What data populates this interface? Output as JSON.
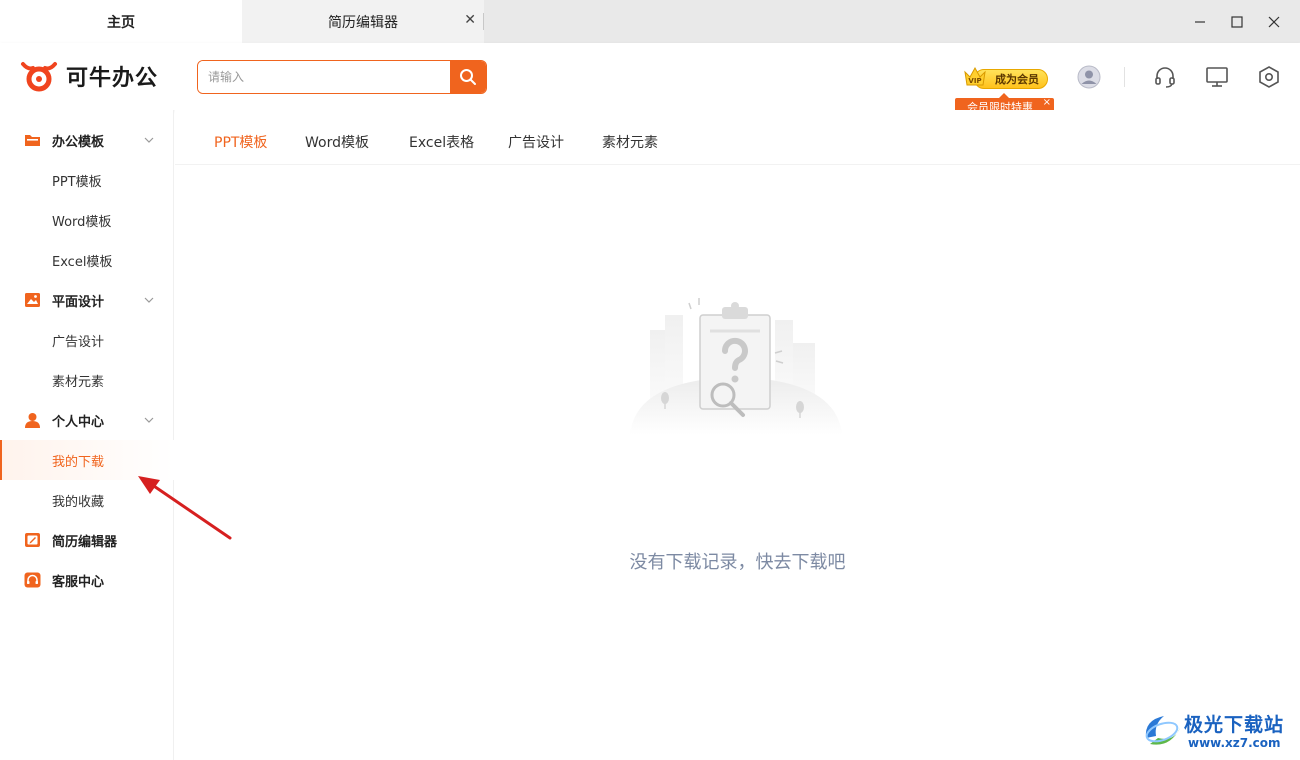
{
  "tabs": [
    {
      "label": "主页",
      "active": true
    },
    {
      "label": "简历编辑器",
      "active": false,
      "close": "✕"
    }
  ],
  "window_controls": [
    "minimize-icon",
    "maximize-icon",
    "close-icon"
  ],
  "header": {
    "app_name": "可牛办公",
    "search": {
      "placeholder": "请输入",
      "value": ""
    },
    "vip_label": "成为会员",
    "vip_badge_text": "VIP",
    "promo_label": "会员限时特惠",
    "promo_close": "×",
    "icons": [
      "avatar-icon",
      "headset-icon",
      "monitor-icon",
      "settings-icon"
    ]
  },
  "sidebar": {
    "groups": [
      {
        "label": "办公模板",
        "icon": "folder-icon",
        "expanded": true,
        "items": [
          "PPT模板",
          "Word模板",
          "Excel模板"
        ]
      },
      {
        "label": "平面设计",
        "icon": "image-icon",
        "expanded": true,
        "items": [
          "广告设计",
          "素材元素"
        ]
      },
      {
        "label": "个人中心",
        "icon": "user-icon",
        "expanded": true,
        "items": [
          "我的下载",
          "我的收藏"
        ]
      },
      {
        "label": "简历编辑器",
        "icon": "edit-icon",
        "expanded": false,
        "items": []
      },
      {
        "label": "客服中心",
        "icon": "headset-icon",
        "expanded": false,
        "items": []
      }
    ],
    "active_item": "我的下载"
  },
  "content": {
    "tabs": [
      "PPT模板",
      "Word模板",
      "Excel表格",
      "广告设计",
      "素材元素"
    ],
    "active_tab": "PPT模板",
    "empty_message": "没有下载记录，快去下载吧"
  },
  "watermark": {
    "title": "极光下载站",
    "url": "www.xz7.com"
  },
  "colors": {
    "accent": "#f0641e",
    "empty_text": "#7d8aa3",
    "watermark": "#1a62c0",
    "arrow": "#d62020"
  }
}
